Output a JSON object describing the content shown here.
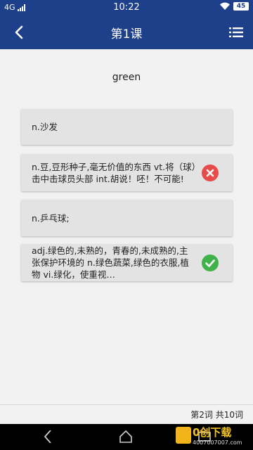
{
  "status": {
    "network": "4G",
    "time": "10:22",
    "battery": "45"
  },
  "header": {
    "title": "第1课"
  },
  "question": {
    "word": "green"
  },
  "options": [
    {
      "text": "n.沙发",
      "mark": ""
    },
    {
      "text": "n.豆,豆形种子,毫无价值的东西 vt.将（球）击中击球员头部 int.胡说！呸！不可能!",
      "mark": "wrong"
    },
    {
      "text": "n.乒乓球;",
      "mark": ""
    },
    {
      "text": "adj.绿色的,未熟的，青春的,未成熟的,主张保护环境的 n.绿色蔬菜,绿色的衣服,植物 vi.绿化，使重视…",
      "mark": "correct"
    }
  ],
  "footer": {
    "counter": "第2词 共10词"
  },
  "colors": {
    "primary": "#1e3f8a",
    "correct": "#3fb24a",
    "wrong": "#e84b4b"
  },
  "watermark": {
    "text": "0创下载",
    "url": "4007007007.com"
  }
}
